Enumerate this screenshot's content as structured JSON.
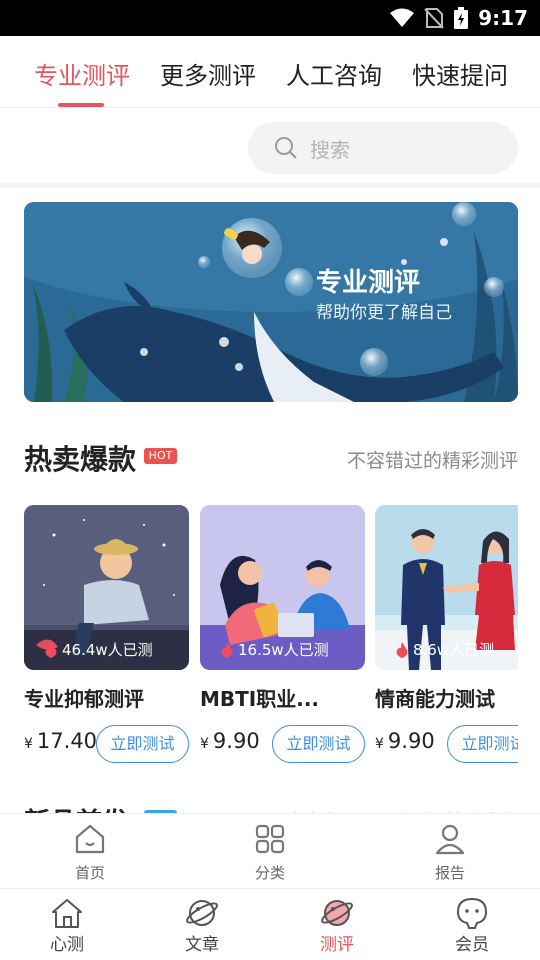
{
  "status_bar": {
    "time": "9:17"
  },
  "tabs": [
    {
      "label": "专业测评",
      "active": true
    },
    {
      "label": "更多测评",
      "active": false
    },
    {
      "label": "人工咨询",
      "active": false
    },
    {
      "label": "快速提问",
      "active": false
    }
  ],
  "search": {
    "placeholder": "搜索"
  },
  "banner": {
    "title": "专业测评",
    "subtitle": "帮助你更了解自己"
  },
  "section": {
    "title": "热卖爆款",
    "badge": "HOT",
    "subtitle": "不容错过的精彩测评"
  },
  "cards": [
    {
      "count": "46.4w人已测",
      "name": "专业抑郁测评",
      "currency": "¥",
      "price": "17.40",
      "button": "立即测试"
    },
    {
      "count": "16.5w人已测",
      "name": "MBTI职业...",
      "currency": "¥",
      "price": "9.90",
      "button": "立即测试"
    },
    {
      "count": "8.6w人已测",
      "name": "情商能力测试",
      "currency": "¥",
      "price": "9.90",
      "button": "立即测试"
    }
  ],
  "next_section": {
    "title": "新品首发",
    "subtitle": "新鲜好玩 最后更新 精彩来袭"
  },
  "sub_nav": [
    {
      "label": "首页",
      "icon": "home-icon"
    },
    {
      "label": "分类",
      "icon": "category-icon"
    },
    {
      "label": "报告",
      "icon": "user-icon"
    }
  ],
  "bottom_nav": [
    {
      "label": "心测",
      "icon": "house-icon",
      "active": false
    },
    {
      "label": "文章",
      "icon": "planet-icon",
      "active": false
    },
    {
      "label": "测评",
      "icon": "planet-icon",
      "active": true
    },
    {
      "label": "会员",
      "icon": "face-icon",
      "active": false
    }
  ],
  "colors": {
    "accent": "#e2575f",
    "link": "#3f8fe0",
    "hot": "#ea5350"
  }
}
